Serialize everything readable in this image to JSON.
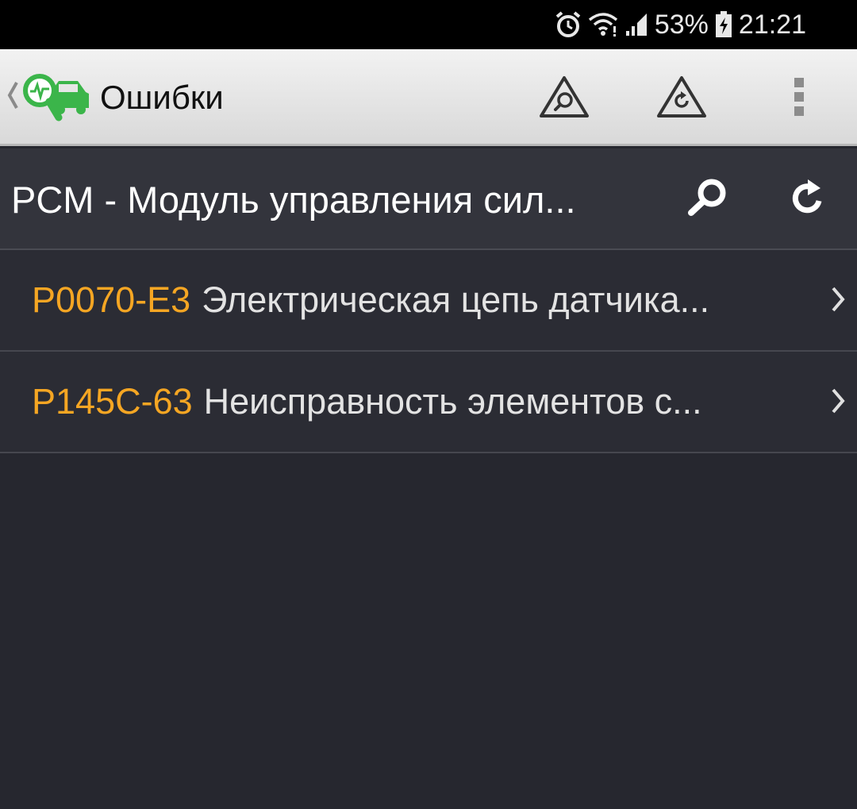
{
  "status_bar": {
    "battery": "53%",
    "time": "21:21",
    "icons": [
      "alarm-icon",
      "wifi-icon",
      "signal-icon",
      "battery-charging-icon"
    ]
  },
  "toolbar": {
    "title": "Ошибки",
    "icons": [
      "back-chevron-icon",
      "app-logo-icon",
      "scan-warning-icon",
      "refresh-warning-icon",
      "more-vertical-icon"
    ]
  },
  "module": {
    "title": "PCM - Модуль управления сил...",
    "icons": [
      "search-icon",
      "refresh-icon"
    ]
  },
  "dtc_list": [
    {
      "code": "P0070-E3",
      "description": "Электрическая цепь датчика..."
    },
    {
      "code": "P145C-63",
      "description": "Неисправность элементов с..."
    }
  ],
  "colors": {
    "status_bar_bg": "#000000",
    "toolbar_bg": "#e6e6e6",
    "header_bg": "#33343c",
    "list_bg": "#2b2c34",
    "page_bg": "#26272f",
    "code_accent": "#f5a623",
    "logo_green": "#3bb54a"
  }
}
